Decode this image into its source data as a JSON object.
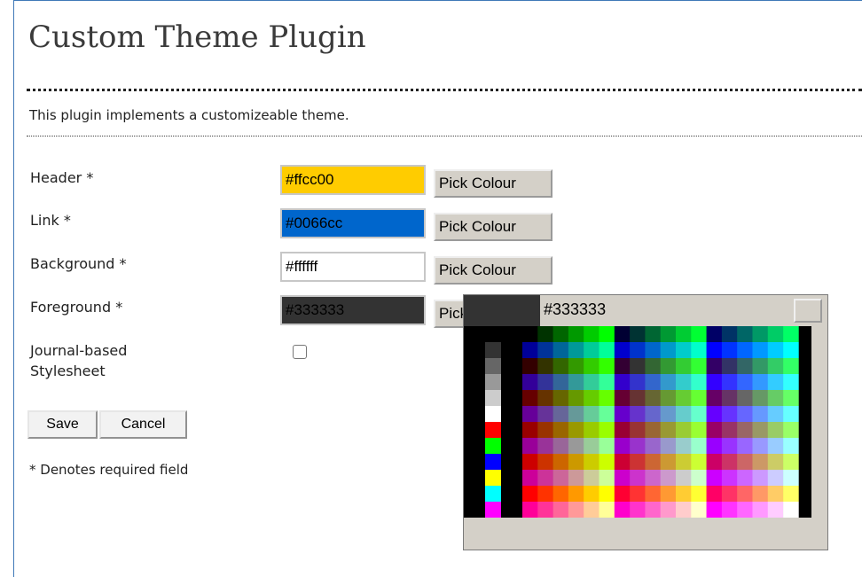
{
  "page": {
    "title": "Custom Theme Plugin",
    "description": "This plugin implements a customizeable theme."
  },
  "form": {
    "fields": [
      {
        "label": "Header *",
        "value": "#ffcc00",
        "background": "#ffcc00",
        "text_color": "#000000",
        "button": "Pick Colour"
      },
      {
        "label": "Link *",
        "value": "#0066cc",
        "background": "#0066cc",
        "text_color": "#000000",
        "button": "Pick Colour"
      },
      {
        "label": "Background *",
        "value": "#ffffff",
        "background": "#ffffff",
        "text_color": "#000000",
        "button": "Pick Colour"
      },
      {
        "label": "Foreground *",
        "value": "#333333",
        "background": "#333333",
        "text_color": "#000000",
        "button": "Pick Colour"
      }
    ],
    "stylesheet_label_line1": "Journal-based",
    "stylesheet_label_line2": "Stylesheet",
    "stylesheet_checked": false,
    "save_label": "Save",
    "cancel_label": "Cancel",
    "required_note": "* Denotes required field"
  },
  "picker": {
    "preview_color": "#333333",
    "hex": "#333333",
    "grays": [
      "#000000",
      "#333333",
      "#666666",
      "#999999",
      "#cccccc",
      "#ffffff",
      "#ff0000",
      "#00ff00",
      "#0000ff",
      "#ffff00",
      "#00ffff",
      "#ff00ff"
    ],
    "levels": [
      "00",
      "33",
      "66",
      "99",
      "cc",
      "ff"
    ]
  },
  "colors": {
    "frame": "#3f79b7",
    "button_face": "#d4d0c8"
  }
}
